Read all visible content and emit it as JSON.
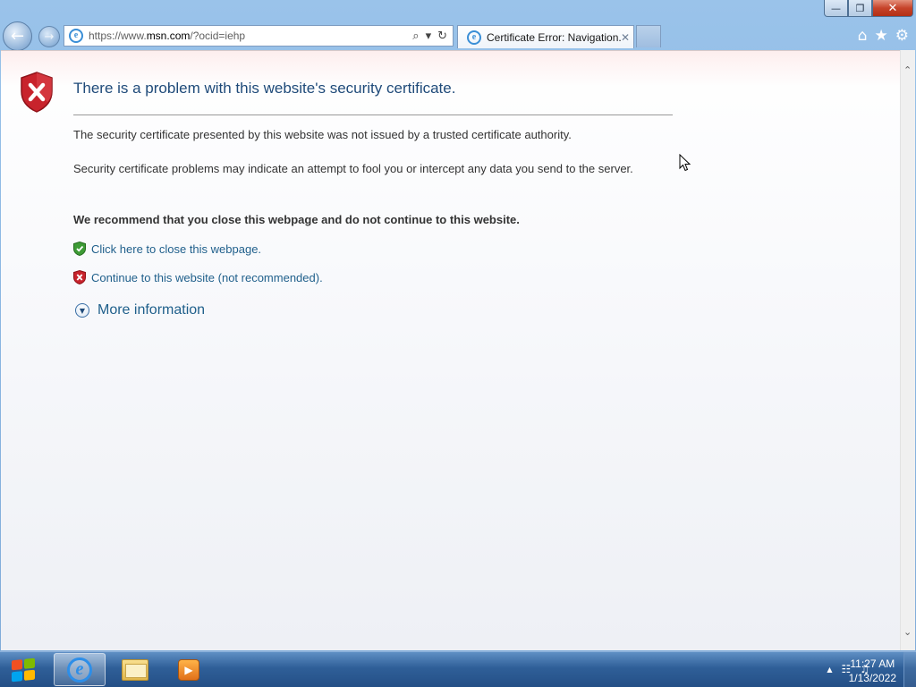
{
  "window": {
    "caption_buttons": {
      "minimize": "—",
      "restore": "❐",
      "close": "✕"
    }
  },
  "navigation": {
    "back_icon": "←",
    "forward_icon": "→",
    "address": {
      "prefix": "https://www.",
      "domain": "msn.com",
      "suffix": "/?ocid=iehp"
    },
    "search_icon": "⌕",
    "dropdown_icon": "▾",
    "refresh_icon": "↻"
  },
  "tabs": [
    {
      "label": "Certificate Error: Navigation...",
      "close": "✕"
    }
  ],
  "toolbar": {
    "home_icon": "⌂",
    "favorites_icon": "★",
    "tools_icon": "⚙"
  },
  "page": {
    "headline": "There is a problem with this website's security certificate.",
    "paragraph1": "The security certificate presented by this website was not issued by a trusted certificate authority.",
    "paragraph2": "Security certificate problems may indicate an attempt to fool you or intercept any data you send to the server.",
    "recommendation": "We recommend that you close this webpage and do not continue to this website.",
    "close_link": "Click here to close this webpage.",
    "continue_link": "Continue to this website (not recommended).",
    "more_info": "More information"
  },
  "taskbar": {
    "tray_arrow": "▲",
    "network_icon": "☷",
    "volume_icon": "♫",
    "time": "11:27 AM",
    "date": "1/13/2022"
  },
  "colors": {
    "headline": "#1f4a79",
    "link": "#1f5f8b",
    "error_shield": "#c8232c",
    "ok_shield": "#3d9b35",
    "taskbar": "#2f5f98"
  }
}
